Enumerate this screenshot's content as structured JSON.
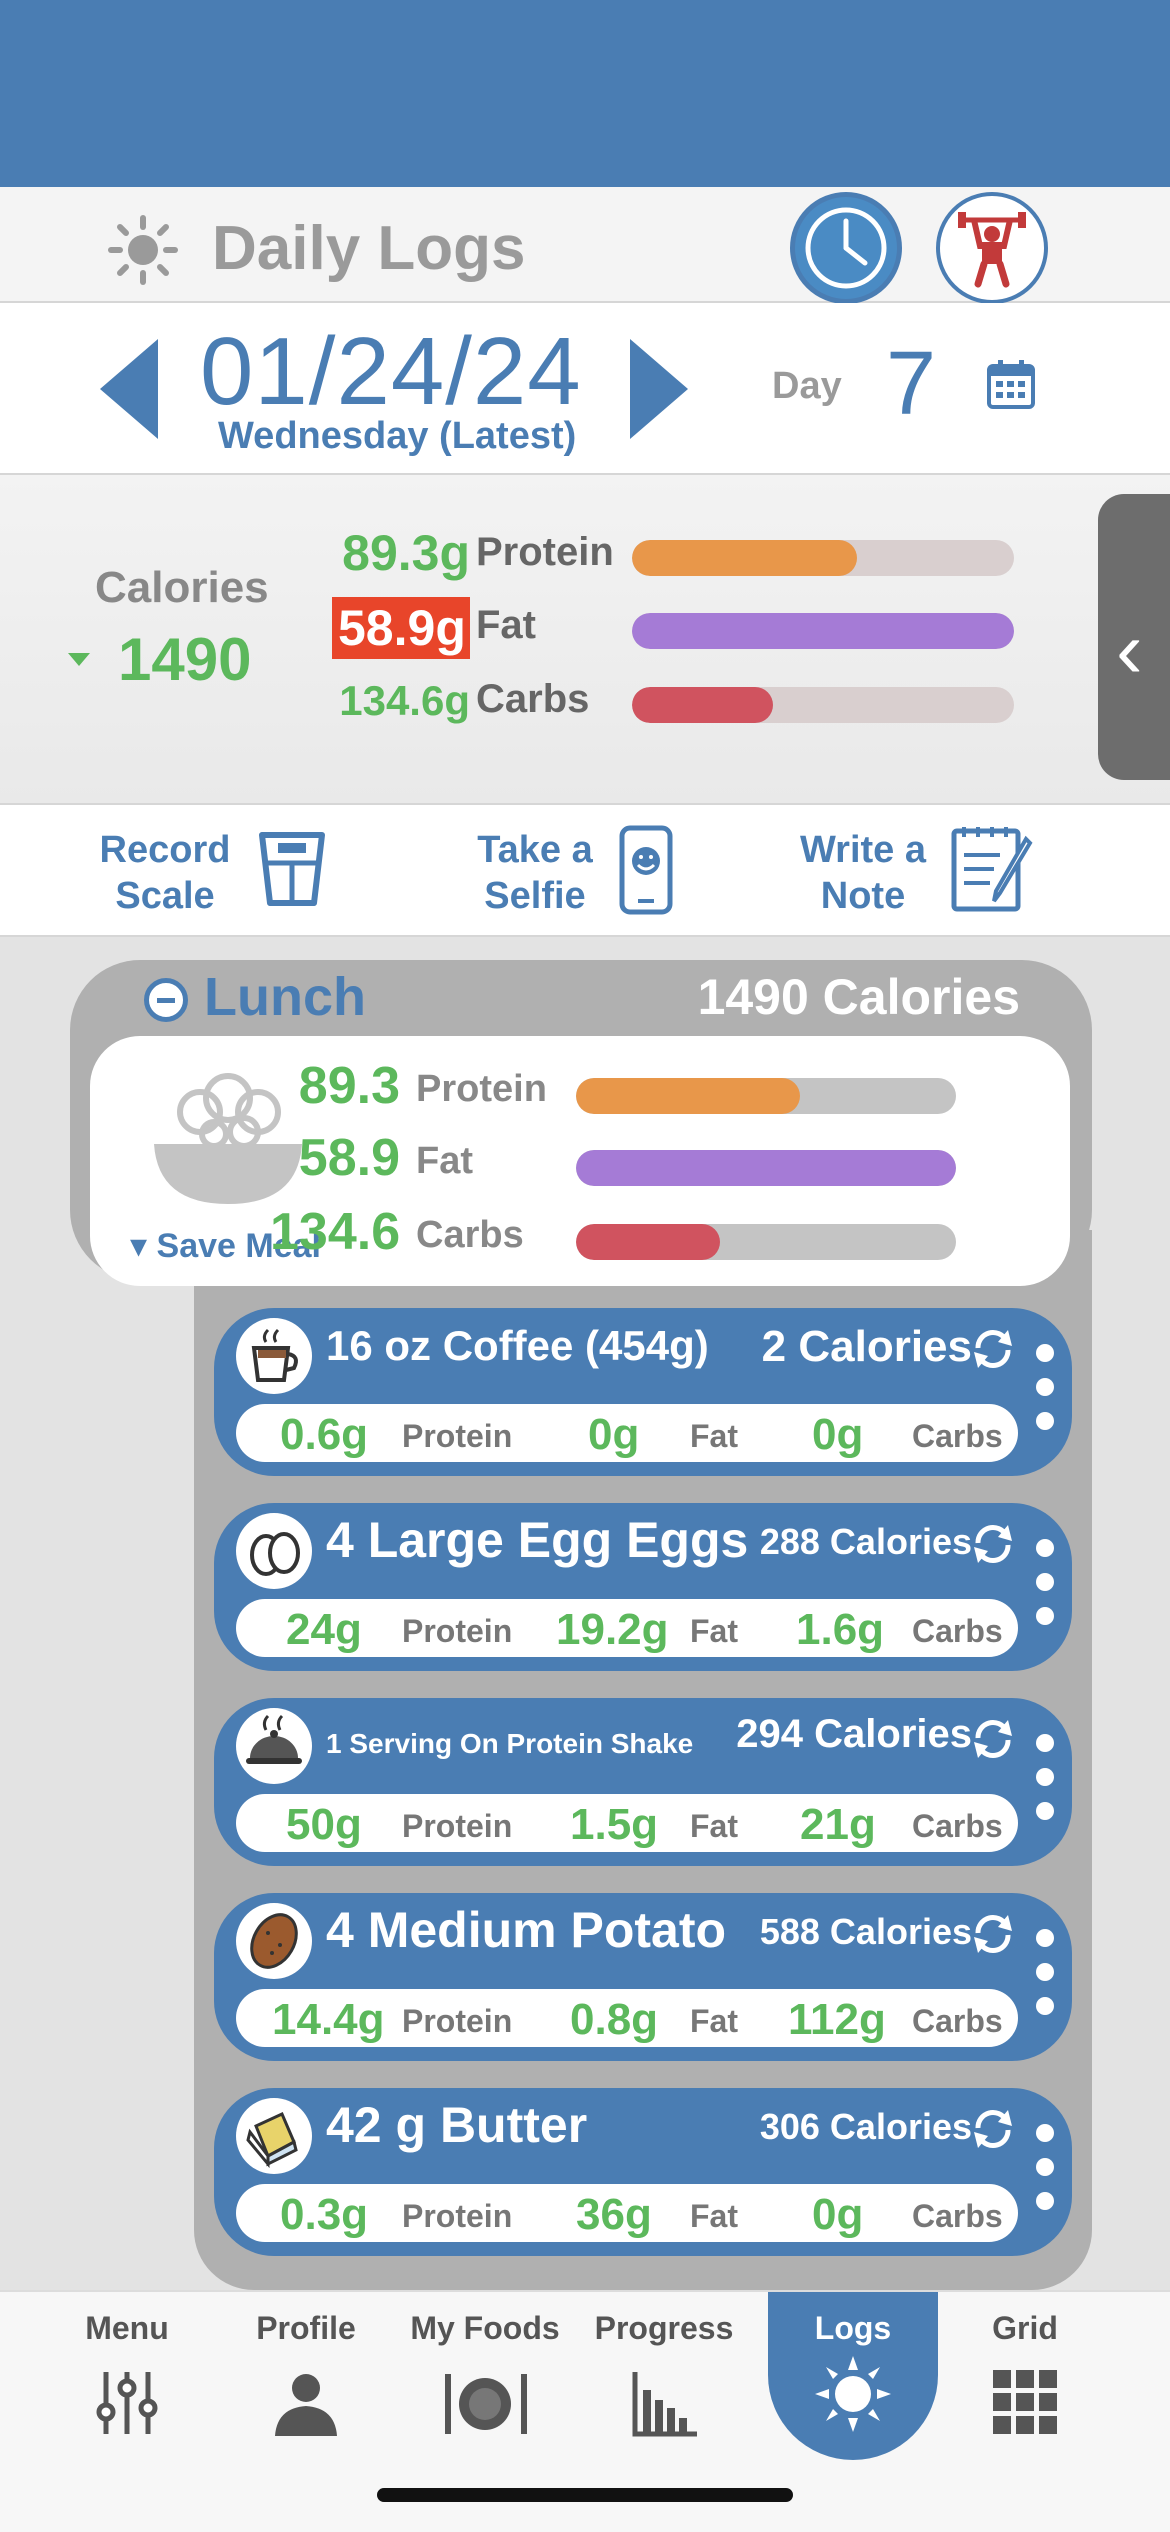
{
  "header": {
    "title": "Daily Logs"
  },
  "date_nav": {
    "date": "01/24/24",
    "weekday": "Wednesday (Latest)",
    "day_label": "Day",
    "day_number": "7"
  },
  "summary": {
    "calories_label": "Calories",
    "calories_value": "1490",
    "macros": [
      {
        "value": "89.3g",
        "label": "Protein",
        "fill_pct": 59,
        "color": "#e8974a",
        "highlight": false
      },
      {
        "value": "58.9g",
        "label": "Fat",
        "fill_pct": 100,
        "color": "#a57bd6",
        "highlight": true
      },
      {
        "value": "134.6g",
        "label": "Carbs",
        "fill_pct": 37,
        "color": "#d0535f",
        "highlight": false
      }
    ]
  },
  "actions": {
    "record_scale": "Record\nScale",
    "take_selfie": "Take a\nSelfie",
    "write_note": "Write a\nNote"
  },
  "meal": {
    "name": "Lunch",
    "total_calories": "1490 Calories",
    "save_label": "Save Meal",
    "rows": [
      {
        "value": "89.3",
        "label": "Protein",
        "fill_pct": 59,
        "color": "#e8974a"
      },
      {
        "value": "58.9",
        "label": "Fat",
        "fill_pct": 100,
        "color": "#a57bd6"
      },
      {
        "value": "134.6",
        "label": "Carbs",
        "fill_pct": 38,
        "color": "#d0535f"
      }
    ]
  },
  "foods": [
    {
      "name": "16 oz Coffee  (454g)",
      "calories": "2 Calories",
      "protein": "0.6g",
      "fat": "0g",
      "carbs": "0g",
      "icon": "coffee-icon"
    },
    {
      "name": "4 Large Egg Eggs",
      "calories": "288 Calories",
      "protein": "24g",
      "fat": "19.2g",
      "carbs": "1.6g",
      "icon": "egg-icon"
    },
    {
      "name": "1 Serving On Protein Shake",
      "calories": "294 Calories",
      "protein": "50g",
      "fat": "1.5g",
      "carbs": "21g",
      "icon": "cloche-icon"
    },
    {
      "name": "4 Medium Potato",
      "calories": "588 Calories",
      "protein": "14.4g",
      "fat": "0.8g",
      "carbs": "112g",
      "icon": "potato-icon"
    },
    {
      "name": "42 g Butter",
      "calories": "306 Calories",
      "protein": "0.3g",
      "fat": "36g",
      "carbs": "0g",
      "icon": "butter-icon"
    }
  ],
  "macro_labels": {
    "protein": "Protein",
    "fat": "Fat",
    "carbs": "Carbs"
  },
  "tabs": [
    {
      "label": "Menu",
      "icon": "sliders-icon"
    },
    {
      "label": "Profile",
      "icon": "person-icon"
    },
    {
      "label": "My Foods",
      "icon": "plate-icon"
    },
    {
      "label": "Progress",
      "icon": "chart-icon"
    },
    {
      "label": "Logs",
      "icon": "sun-icon",
      "active": true
    },
    {
      "label": "Grid",
      "icon": "grid-icon"
    }
  ],
  "colors": {
    "brand_blue": "#4a7db3",
    "green_value": "#5cb85c",
    "warning_red": "#e8452a"
  }
}
